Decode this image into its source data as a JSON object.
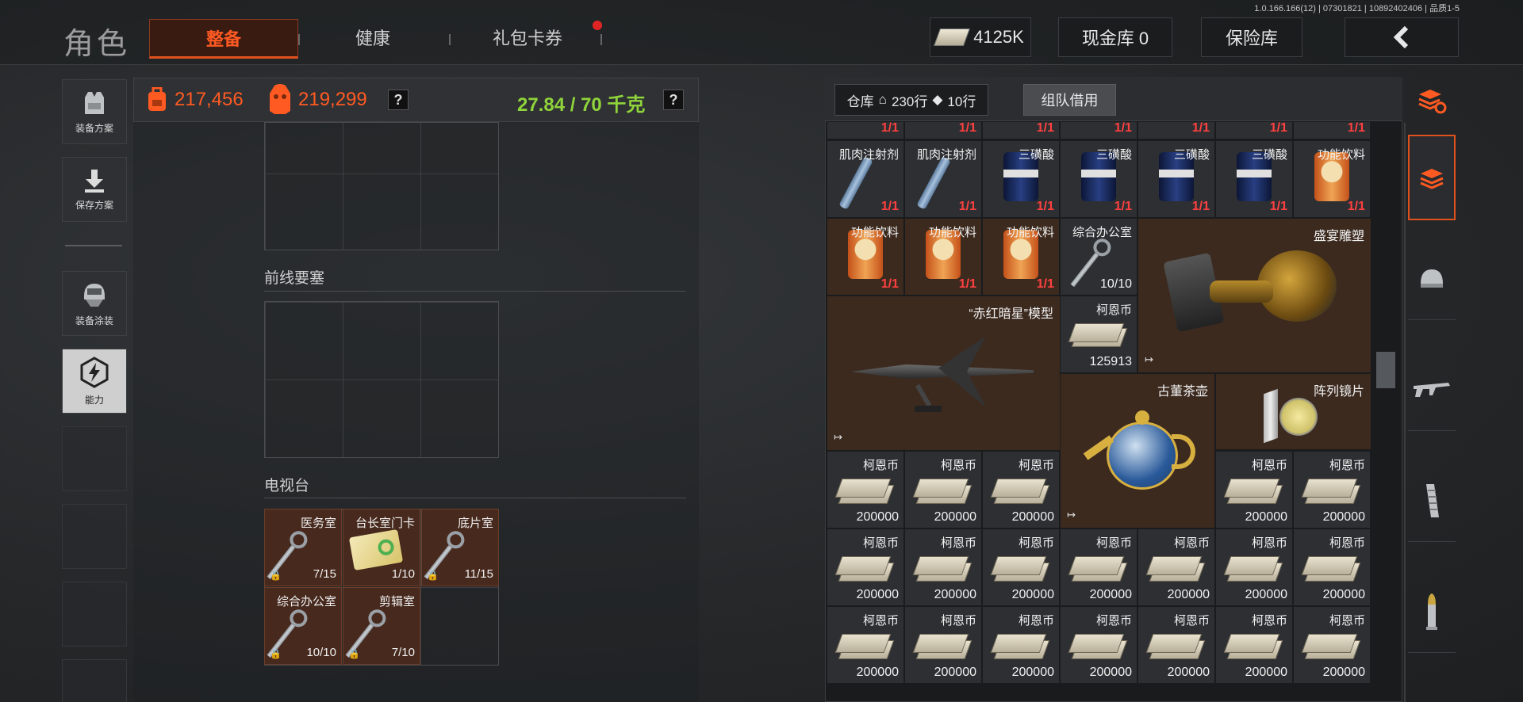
{
  "build_info": "1.0.166.166(12) | 07301821 | 10892402406 | 品质1-5",
  "title": "角色",
  "tabs": [
    {
      "label": "整备",
      "active": true
    },
    {
      "label": "健康",
      "active": false
    },
    {
      "label": "礼包卡券",
      "active": false,
      "badge": "red-dot"
    }
  ],
  "top_right": {
    "money": "4125K",
    "cash_vault": "现金库 0",
    "safe_box": "保险库",
    "back_icon": "chevron-left-icon"
  },
  "left_rail": [
    {
      "label": "装备方案",
      "icon": "vest-icon"
    },
    {
      "label": "保存方案",
      "icon": "download-icon"
    },
    {
      "label": "装备涂装",
      "icon": "helmet-icon"
    },
    {
      "label": "能力",
      "icon": "lightning-hex-icon",
      "active": true
    }
  ],
  "stats": {
    "backpack_value": "217,456",
    "body_value": "219,299",
    "help": "?",
    "weight": "27.84 / 70 千克"
  },
  "sections": [
    {
      "title": "前线要塞"
    },
    {
      "title": "电视台"
    }
  ],
  "keys": [
    {
      "name": "医务室",
      "count": "7/15"
    },
    {
      "name": "台长室门卡",
      "count": "1/10"
    },
    {
      "name": "底片室",
      "count": "11/15"
    },
    {
      "name": "综合办公室",
      "count": "10/10"
    },
    {
      "name": "剪辑室",
      "count": "7/10"
    }
  ],
  "warehouse": {
    "label": "仓库",
    "rows": "230行",
    "extra_rows": "10行",
    "borrow_button": "组队借用",
    "row0": [
      "1/1",
      "1/1",
      "1/1",
      "1/1",
      "1/1",
      "1/1",
      "1/1"
    ],
    "row1": [
      {
        "name": "肌肉注射剂",
        "count": "1/1"
      },
      {
        "name": "肌肉注射剂",
        "count": "1/1"
      },
      {
        "name": "三磺酸",
        "count": "1/1"
      },
      {
        "name": "三磺酸",
        "count": "1/1"
      },
      {
        "name": "三磺酸",
        "count": "1/1"
      },
      {
        "name": "三磺酸",
        "count": "1/1"
      },
      {
        "name": "功能饮料",
        "count": "1/1"
      }
    ],
    "row2": [
      {
        "name": "功能饮料",
        "count": "1/1"
      },
      {
        "name": "功能饮料",
        "count": "1/1"
      },
      {
        "name": "功能饮料",
        "count": "1/1"
      },
      {
        "name": "综合办公室",
        "count": "10/10"
      }
    ],
    "feast_sculpture": "盛宴雕塑",
    "model": "“赤红暗星”模型",
    "koen_single": {
      "name": "柯恩币",
      "count": "125913"
    },
    "teapot": "古董茶壶",
    "lens": "阵列镜片",
    "koen_name": "柯恩币",
    "koen_count": "200000"
  }
}
